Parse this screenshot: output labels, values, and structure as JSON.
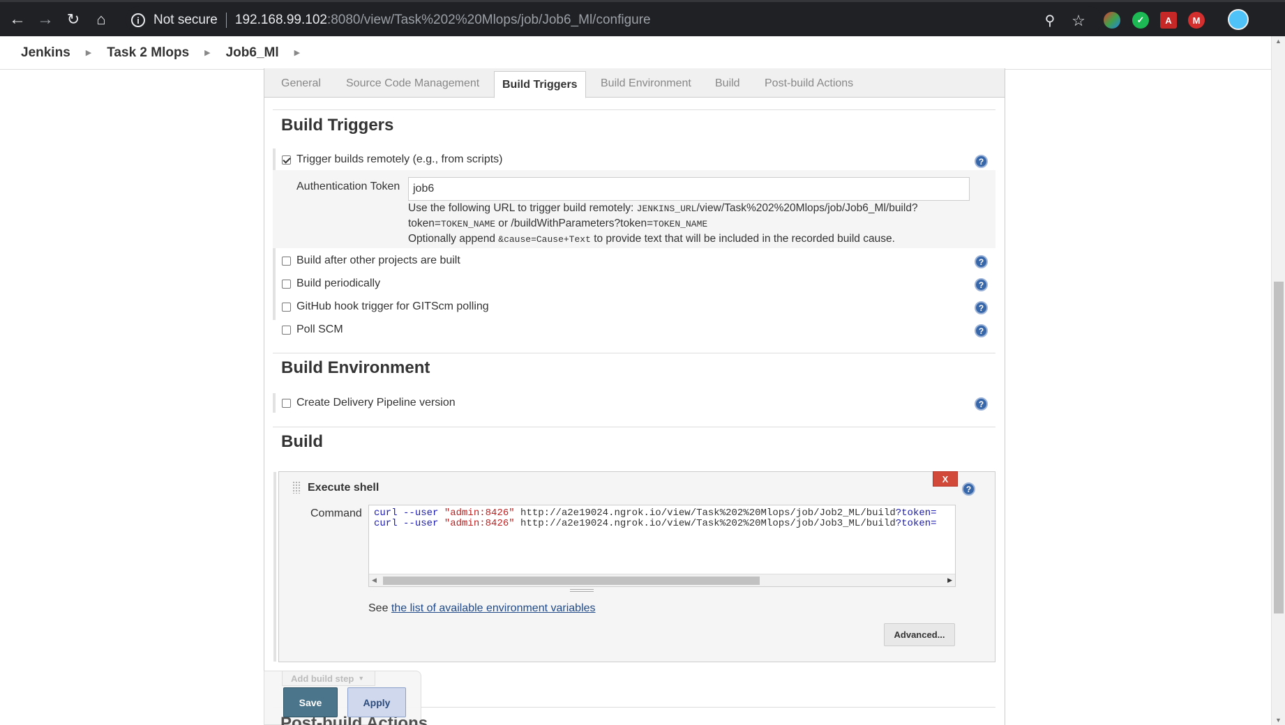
{
  "browser": {
    "not_secure": "Not secure",
    "url_host": "192.168.99.102",
    "url_rest": ":8080/view/Task%202%20Mlops/job/Job6_Ml/configure"
  },
  "breadcrumbs": [
    "Jenkins",
    "Task 2 Mlops",
    "Job6_Ml"
  ],
  "tabs": [
    "General",
    "Source Code Management",
    "Build Triggers",
    "Build Environment",
    "Build",
    "Post-build Actions"
  ],
  "active_tab": "Build Triggers",
  "build_triggers": {
    "title": "Build Triggers",
    "remote": {
      "label": "Trigger builds remotely (e.g., from scripts)",
      "checked": true
    },
    "auth_token": {
      "label": "Authentication Token",
      "value": "job6",
      "help_line1_a": "Use the following URL to trigger build remotely: ",
      "help_line1_code": "JENKINS_URL",
      "help_line1_b": "/view/Task%202%20Mlops/job/Job6_Ml/build?",
      "help_line2_a": "token=",
      "help_line2_code1": "TOKEN_NAME",
      "help_line2_b": " or /buildWithParameters?token=",
      "help_line2_code2": "TOKEN_NAME",
      "help_line3_a": "Optionally append ",
      "help_line3_code": "&cause=Cause+Text",
      "help_line3_b": " to provide text that will be included in the recorded build cause."
    },
    "options": [
      "Build after other projects are built",
      "Build periodically",
      "GitHub hook trigger for GITScm polling",
      "Poll SCM"
    ]
  },
  "build_environment": {
    "title": "Build Environment",
    "options": [
      "Create Delivery Pipeline version"
    ]
  },
  "build": {
    "title": "Build",
    "step_title": "Execute shell",
    "delete_label": "X",
    "command_label": "Command",
    "commands": [
      {
        "cmd": "curl",
        "flag": " --user ",
        "cred": "\"admin:8426\"",
        "url": " http://a2e19024.ngrok.io/view/Task%202%20Mlops/job/Job2_ML/build",
        "tail": "?token="
      },
      {
        "cmd": "curl",
        "flag": " --user ",
        "cred": "\"admin:8426\"",
        "url": " http://a2e19024.ngrok.io/view/Task%202%20Mlops/job/Job3_ML/build",
        "tail": "?token="
      }
    ],
    "see_prefix": "See ",
    "env_link": "the list of available environment variables",
    "advanced_label": "Advanced...",
    "add_step_label": "Add build step"
  },
  "post_build_title": "Post-build Actions",
  "buttons": {
    "save": "Save",
    "apply": "Apply"
  },
  "help_glyph": "?",
  "colors": {
    "save": "#4b758b",
    "apply": "#cfd8ec",
    "delete": "#d24939",
    "help": "#3766a9"
  }
}
